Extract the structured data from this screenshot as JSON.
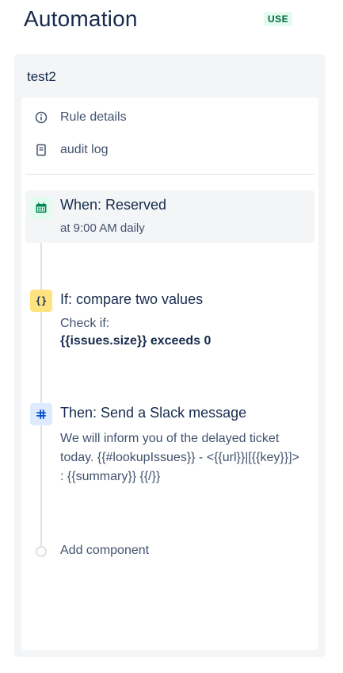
{
  "header": {
    "title": "Automation",
    "badge": "USE"
  },
  "rule": {
    "name": "test2",
    "menu": [
      {
        "label": "Rule details",
        "icon": "info-icon"
      },
      {
        "label": "audit log",
        "icon": "document-icon"
      }
    ],
    "trigger": {
      "title": "When: Reserved",
      "description": "at 9:00 AM daily",
      "icon": "calendar-icon",
      "color": "#00875a"
    },
    "condition": {
      "title": "If: compare two values",
      "line1": "Check if:",
      "line2": "{{issues.size}} exceeds 0",
      "icon": "braces-icon",
      "icon_text": "{}",
      "color": "#ffe380"
    },
    "action": {
      "title": "Then: Send a Slack message",
      "description": "We will inform you of the delayed ticket today. {{#lookupIssues}} - <{{url}}|[{{key}}]> : {{summary}} {{/}}",
      "icon": "slack-icon",
      "color": "#deebff"
    },
    "add_component": "Add component"
  }
}
